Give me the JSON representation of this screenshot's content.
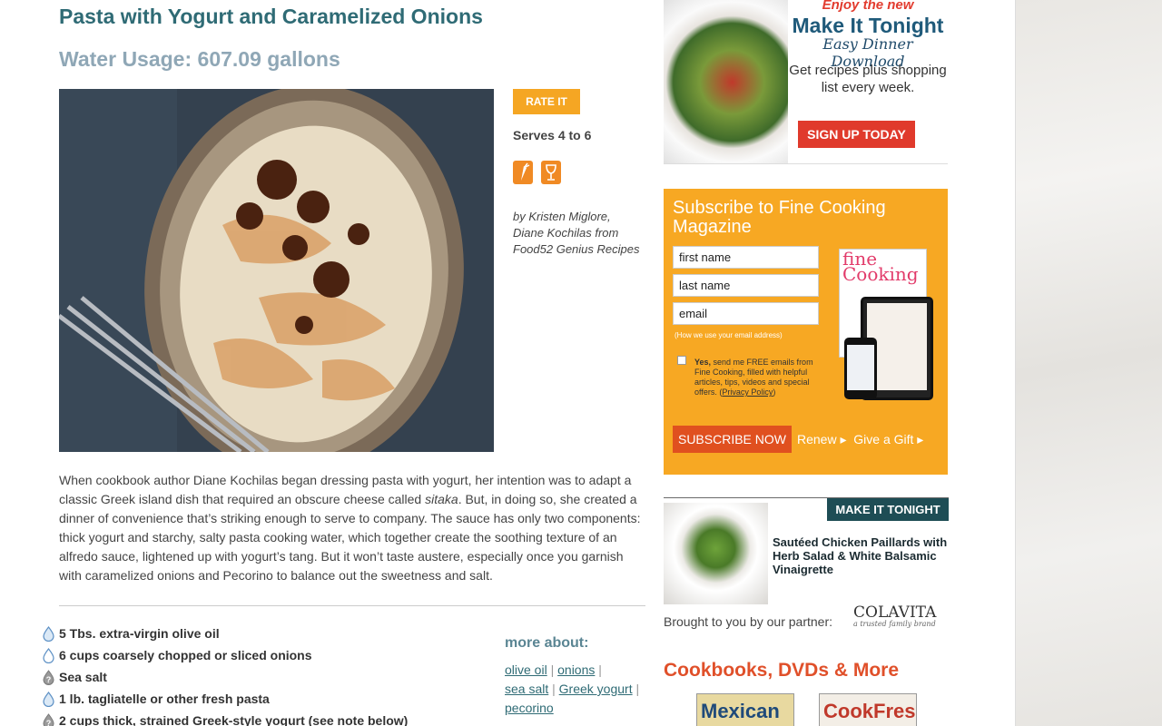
{
  "recipe": {
    "title": "Pasta with Yogurt and Caramelized Onions",
    "water_usage": "Water Usage: 607.09 gallons",
    "rate_label": "RATE IT",
    "serves": "Serves 4 to 6",
    "byline": "by Kristen Miglore, Diane Kochilas from Food52 Genius Recipes",
    "intro_pre": "When cookbook author Diane Kochilas began dressing pasta with yogurt, her intention was to adapt a classic Greek island dish that required an obscure cheese called ",
    "intro_em": "sitaka",
    "intro_post": ". But, in doing so, she created a dinner of convenience that’s striking enough to serve to company. The sauce has only two components: thick yogurt and starchy, salty pasta cooking water, which together create the soothing texture of an alfredo sauce, lightened up with yogurt’s tang. But it won’t taste austere, especially once you garnish with caramelized onions and Pecorino to balance out the sweetness and salt.",
    "ingredients": [
      {
        "text": "5 Tbs. extra-virgin olive oil",
        "icon": "water-drop-icon"
      },
      {
        "text": "6 cups coarsely chopped or sliced onions",
        "icon": "water-drop-icon"
      },
      {
        "text": "Sea salt",
        "icon": "unknown-drop-icon"
      },
      {
        "text": "1 lb. tagliatelle or other fresh pasta",
        "icon": "water-drop-icon"
      },
      {
        "text": "2 cups thick, strained Greek-style yogurt (see note below)",
        "icon": "unknown-drop-icon"
      }
    ],
    "more_about": {
      "heading": "more about:",
      "tags": [
        "olive oil",
        "onions",
        "sea salt",
        "Greek yogurt",
        "pecorino"
      ]
    }
  },
  "ad": {
    "enjoy": "Enjoy the new",
    "headline": "Make It Tonight",
    "sub": "Easy Dinner Download",
    "body": "Get recipes plus shopping list every week.",
    "cta": "SIGN UP TODAY"
  },
  "subscribe": {
    "title": "Subscribe to Fine Cooking Magazine",
    "first_name_placeholder": "first name",
    "last_name_placeholder": "last name",
    "email_placeholder": "email",
    "how_text": "(How we use your email address)",
    "yes_bold": "Yes,",
    "yes_text": " send me FREE emails from Fine Cooking, filled with helpful articles, tips, videos and special offers. (",
    "privacy": "Privacy Policy",
    "yes_end": ")",
    "button": "SUBSCRIBE NOW",
    "renew": "Renew ▸",
    "gift": "Give a Gift ▸",
    "mag_brand": "fine Cooking"
  },
  "make_it_tonight": {
    "badge": "MAKE IT TONIGHT",
    "title": "Sautéed Chicken Paillards with Herb Salad & White Balsamic Vinaigrette",
    "brought": "Brought to you by our partner:",
    "partner": "COLAVITA",
    "partner_tag": "a trusted family brand"
  },
  "books": {
    "title": "Cookbooks, DVDs & More",
    "items": [
      "Mexican",
      "CookFresh"
    ]
  },
  "colors": {
    "teal": "#2f6b75",
    "orange": "#f7a823",
    "red": "#e03a2c"
  }
}
